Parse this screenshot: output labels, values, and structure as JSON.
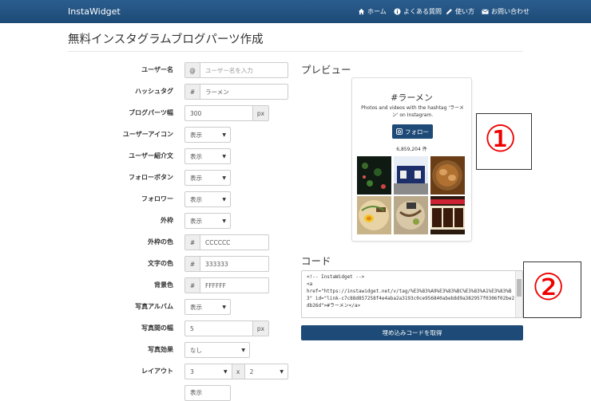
{
  "nav": {
    "brand": "InstaWidget",
    "items": [
      {
        "label": "ホーム",
        "icon": "home-icon"
      },
      {
        "label": "よくある質問",
        "icon": "info-icon"
      },
      {
        "label": "使い方",
        "icon": "pencil-icon"
      },
      {
        "label": "お問い合わせ",
        "icon": "mail-icon"
      }
    ]
  },
  "page_title": "無料インスタグラムブログパーツ作成",
  "form": {
    "username": {
      "label": "ユーザー名",
      "addon": "@",
      "placeholder": "ユーザー名を入力"
    },
    "hashtag": {
      "label": "ハッシュタグ",
      "addon": "#",
      "value": "ラーメン"
    },
    "width": {
      "label": "ブログパーツ幅",
      "value": "300",
      "unit": "px"
    },
    "user_icon": {
      "label": "ユーザーアイコン",
      "value": "表示"
    },
    "user_intro": {
      "label": "ユーザー紹介文",
      "value": "表示"
    },
    "follow_button": {
      "label": "フォローボタン",
      "value": "表示"
    },
    "followers": {
      "label": "フォロワー",
      "value": "表示"
    },
    "border": {
      "label": "外枠",
      "value": "表示"
    },
    "border_color": {
      "label": "外枠の色",
      "addon": "#",
      "value": "CCCCCC"
    },
    "text_color": {
      "label": "文字の色",
      "addon": "#",
      "value": "333333"
    },
    "bg_color": {
      "label": "背景色",
      "addon": "#",
      "value": "FFFFFF"
    },
    "album": {
      "label": "写真アルバム",
      "value": "表示"
    },
    "photo_gap": {
      "label": "写真間の幅",
      "value": "5",
      "unit": "px"
    },
    "effect": {
      "label": "写真効果",
      "value": "なし"
    },
    "layout": {
      "label": "レイアウト",
      "cols": "3",
      "x": "x",
      "rows": "2"
    },
    "partial_value": "表示"
  },
  "preview": {
    "heading": "プレビュー",
    "tag": "#ラーメン",
    "description": "Photos and videos with the hashtag 'ラーメン' on Instagram.",
    "follow_label": "フォロー",
    "count": "6,859,204 件"
  },
  "code": {
    "heading": "コード",
    "text": "<!-- InstaWidget -->\n<a\nhref=\"https://instawidget.net/v/tag/%E3%83%A9%E3%83%BC%E3%83%A1%E3%83%B3\" id=\"link-c7c88d857258f4e4aba2a3193c0ce956840abeb8d9a382957f0306f02be2db26d\">#ラーメン</a>",
    "button": "埋め込みコードを取得"
  },
  "markers": {
    "first": "①",
    "second": "②"
  },
  "colors": {
    "nav": "#1d4a76",
    "accent": "#1d4a76",
    "marker": "#e00000"
  }
}
